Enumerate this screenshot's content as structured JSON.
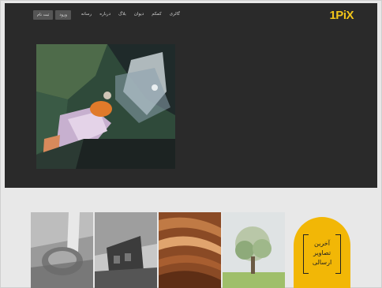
{
  "header": {
    "logo": "1PiX",
    "nav": [
      "گالری",
      "کمکم",
      "دیوان",
      "بلاگ",
      "درباره",
      "رسانه"
    ],
    "auth": {
      "login": "ورود",
      "register": "ثبت نام"
    }
  },
  "featured": {
    "alt": "featured-photo"
  },
  "latest": {
    "badge_lines": [
      "آخرین",
      "تصاویر",
      "ارسالی"
    ],
    "thumbnails": [
      "tree-photo",
      "wood-texture-photo",
      "building-photo",
      "tree-stump-photo"
    ]
  },
  "colors": {
    "hero_bg": "#2a2a2a",
    "accent": "#f2b706",
    "logo": "#f0c419"
  }
}
